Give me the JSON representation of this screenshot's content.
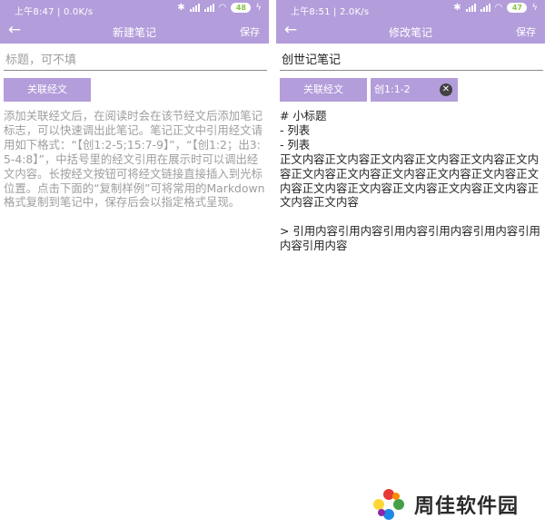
{
  "colors": {
    "accent": "#b39ddb",
    "battery": "#8bc34a",
    "hint_text": "#9e9e9e"
  },
  "left": {
    "status": {
      "time": "上午8:47 | 0.0K/s",
      "battery": "48"
    },
    "appbar": {
      "back_icon": "arrow-left-icon",
      "title": "新建笔记",
      "save": "保存"
    },
    "title_placeholder": "标题，可不填",
    "link_button": "关联经文",
    "hint": "添加关联经文后，在阅读时会在该节经文后添加笔记标志，可以快速调出此笔记。笔记正文中引用经文请用如下格式：“【创1:2-5;15:7-9】”，“【创1:2；出3:5-4:8】”，中括号里的经文引用在展示时可以调出经文内容。长按经文按钮可将经文链接直接插入到光标位置。点击下面的“复制样例”可将常用的Markdown格式复制到笔记中，保存后会以指定格式呈现。"
  },
  "right": {
    "status": {
      "time": "上午8:51 | 2.0K/s",
      "battery": "47"
    },
    "appbar": {
      "back_icon": "arrow-left-icon",
      "title": "修改笔记",
      "save": "保存"
    },
    "title_value": "创世记笔记",
    "link_button": "关联经文",
    "ref_value": "创1:1-2",
    "body": "# 小标题\n- 列表\n- 列表\n正文内容正文内容正文内容正文内容正文内容正文内容正文内容正文内容正文内容正文内容正文内容正文内容正文内容正文内容正文内容正文内容正文内容正文内容正文内容\n\n> 引用内容引用内容引用内容引用内容引用内容引用内容引用内容"
  },
  "watermark": {
    "text": "周佳软件园"
  }
}
